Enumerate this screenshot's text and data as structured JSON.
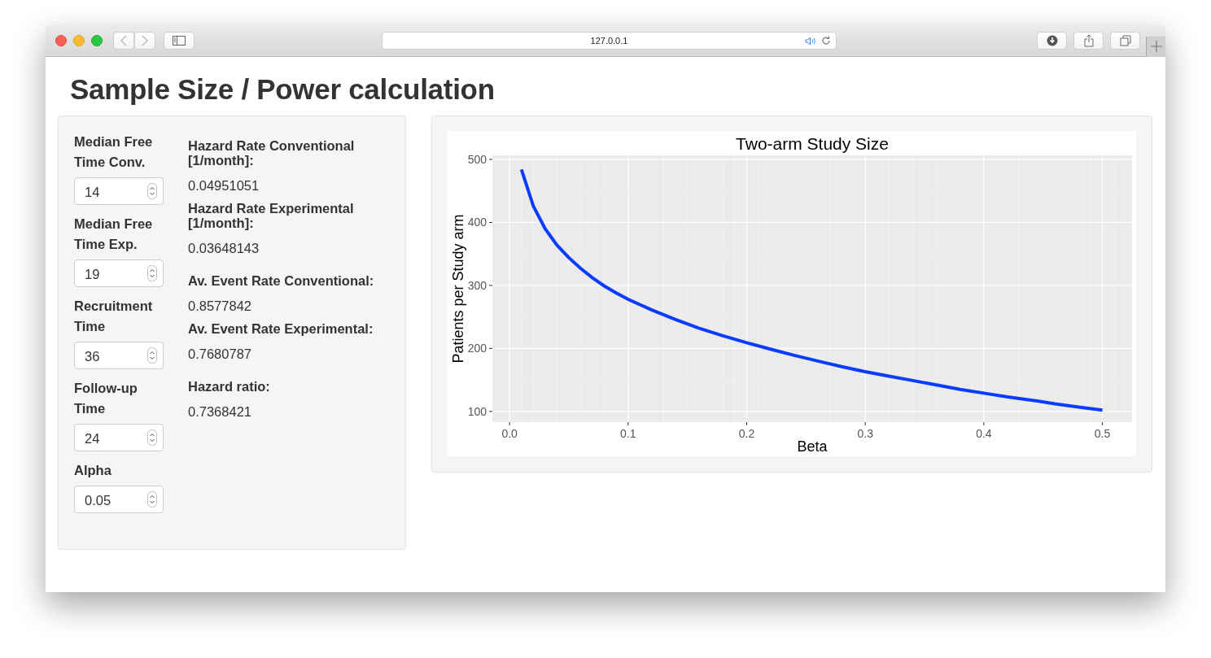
{
  "browser": {
    "address": "127.0.0.1"
  },
  "title": "Sample Size / Power calculation",
  "inputs": [
    {
      "label": "Median Free Time Conv.",
      "value": "14"
    },
    {
      "label": "Median Free Time Exp.",
      "value": "19"
    },
    {
      "label": "Recruitment Time",
      "value": "36"
    },
    {
      "label": "Follow-up Time",
      "value": "24"
    },
    {
      "label": "Alpha",
      "value": "0.05"
    }
  ],
  "output_groups": [
    [
      {
        "label": "Hazard Rate Conventional [1/month]:",
        "value": "0.04951051"
      },
      {
        "label": "Hazard Rate Experimental [1/month]:",
        "value": "0.03648143"
      }
    ],
    [
      {
        "label": "Av. Event Rate Conventional:",
        "value": "0.8577842"
      },
      {
        "label": "Av. Event Rate Experimental:",
        "value": "0.7680787"
      }
    ],
    [
      {
        "label": "Hazard ratio:",
        "value": "0.7368421"
      }
    ]
  ],
  "plot": {
    "chart_data": {
      "type": "line",
      "title": "Two-arm Study Size",
      "xlabel": "Beta",
      "ylabel": "Patients per Study arm",
      "x": [
        0.01,
        0.02,
        0.03,
        0.04,
        0.05,
        0.06,
        0.07,
        0.08,
        0.09,
        0.1,
        0.12,
        0.14,
        0.16,
        0.18,
        0.2,
        0.22,
        0.24,
        0.26,
        0.28,
        0.3,
        0.32,
        0.34,
        0.36,
        0.38,
        0.4,
        0.42,
        0.44,
        0.46,
        0.48,
        0.5
      ],
      "grid": true,
      "series": [
        {
          "color": "#0a3cff",
          "values": [
            484,
            426,
            390,
            364,
            344,
            327,
            312,
            299,
            288,
            278,
            261,
            246,
            232,
            220,
            209,
            199,
            189,
            180,
            171,
            163,
            156,
            149,
            142,
            135,
            129,
            123,
            118,
            112,
            107,
            102
          ]
        }
      ],
      "xlim": [
        -0.0145,
        0.525
      ],
      "ylim": [
        83,
        506.5
      ],
      "xticks": [
        {
          "value": 0,
          "label": "0.0"
        },
        0.1,
        0.2,
        0.3,
        0.4,
        0.5
      ],
      "yticks": [
        100,
        200,
        300,
        400,
        500
      ]
    }
  }
}
